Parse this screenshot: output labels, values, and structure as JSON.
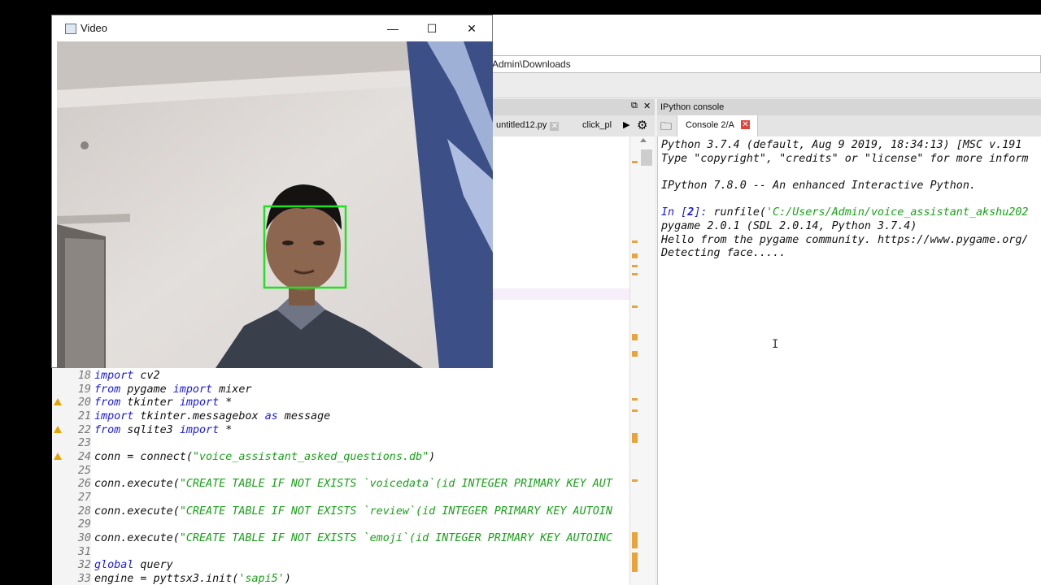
{
  "video_window": {
    "title": "Video",
    "minimize": "—",
    "maximize": "☐",
    "close": "✕"
  },
  "ide": {
    "path": "Admin\\Downloads",
    "editor_tabs": [
      {
        "label": "untitled12.py",
        "close": "✕"
      },
      {
        "label": "click_pl",
        "close": ""
      }
    ],
    "console_pane_title": "IPython console",
    "console_tab": {
      "label": "Console 2/A",
      "close": "✕"
    }
  },
  "editor": {
    "lines": [
      {
        "n": "18",
        "warn": false
      },
      {
        "n": "19",
        "warn": false
      },
      {
        "n": "20",
        "warn": true
      },
      {
        "n": "21",
        "warn": false
      },
      {
        "n": "22",
        "warn": true
      },
      {
        "n": "23",
        "warn": false
      },
      {
        "n": "24",
        "warn": true
      },
      {
        "n": "25",
        "warn": false
      },
      {
        "n": "26",
        "warn": false
      },
      {
        "n": "27",
        "warn": false
      },
      {
        "n": "28",
        "warn": false
      },
      {
        "n": "29",
        "warn": false
      },
      {
        "n": "30",
        "warn": false
      },
      {
        "n": "31",
        "warn": false
      },
      {
        "n": "32",
        "warn": false
      },
      {
        "n": "33",
        "warn": false
      }
    ],
    "code": {
      "l18_kw": "import",
      "l18_rest": " cv2",
      "l19_kw1": "from",
      "l19_mod": " pygame ",
      "l19_kw2": "import",
      "l19_rest": " mixer",
      "l20_kw1": "from",
      "l20_mod": " tkinter ",
      "l20_kw2": "import",
      "l20_rest": " *",
      "l21_kw1": "import",
      "l21_mod": " tkinter.messagebox ",
      "l21_kw2": "as",
      "l21_rest": " message",
      "l22_kw1": "from",
      "l22_mod": " sqlite3 ",
      "l22_kw2": "import",
      "l22_rest": " *",
      "l24_pre": "conn = connect(",
      "l24_str": "\"voice_assistant_asked_questions.db\"",
      "l24_post": ")",
      "l26_pre": "conn.execute(",
      "l26_str": "\"CREATE TABLE IF NOT EXISTS `voicedata`(id INTEGER PRIMARY KEY AUT",
      "l28_pre": "conn.execute(",
      "l28_str": "\"CREATE TABLE IF NOT EXISTS `review`(id INTEGER PRIMARY KEY AUTOIN",
      "l30_pre": "conn.execute(",
      "l30_str": "\"CREATE TABLE IF NOT EXISTS `emoji`(id INTEGER PRIMARY KEY AUTOINC",
      "l32_kw": "global",
      "l32_rest": " query",
      "l33_pre": "engine = pyttsx3.init(",
      "l33_str": "'sapi5'",
      "l33_post": ")"
    }
  },
  "console": {
    "line1": "Python 3.7.4 (default, Aug  9 2019, 18:34:13) [MSC v.191",
    "line2": "Type \"copyright\", \"credits\" or \"license\" for more inform",
    "line3": "IPython 7.8.0 -- An enhanced Interactive Python.",
    "prompt_in": "In [",
    "prompt_num": "2",
    "prompt_close": "]: ",
    "cmd_pre": "runfile(",
    "cmd_str": "'C:/Users/Admin/voice_assistant_akshu202",
    "line5": "pygame 2.0.1 (SDL 2.0.14, Python 3.7.4)",
    "line6": "Hello from the pygame community. https://www.pygame.org/",
    "line7": "Detecting face....."
  },
  "colors": {
    "keyword": "#1a1ae6",
    "string": "#19a119",
    "face_box": "#22e022",
    "warning": "#e6a400"
  }
}
